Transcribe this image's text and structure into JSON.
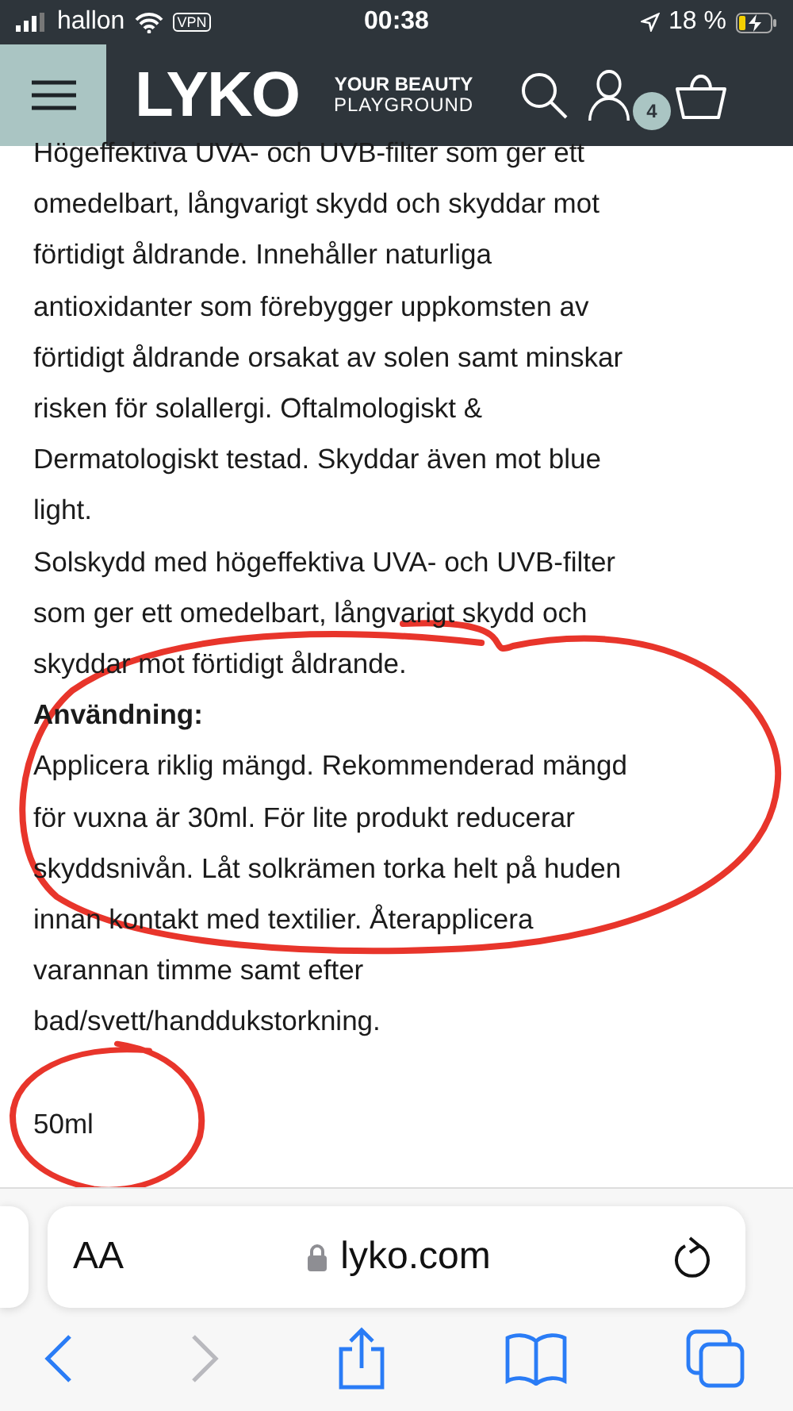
{
  "status_bar": {
    "carrier": "hallon",
    "vpn": "VPN",
    "time": "00:38",
    "battery": "18 %"
  },
  "header": {
    "logo": "LYKO",
    "tagline_top": "YOUR BEAUTY",
    "tagline_bottom": "PLAYGROUND",
    "cart_count": "4"
  },
  "content": [
    {
      "kind": "paragraph",
      "lines": [
        "Högeffektiva UVA- och UVB-filter som ger ett",
        "omedelbart, långvarigt skydd och skyddar mot",
        "förtidigt åldrande. Innehåller naturliga",
        "antioxidanter som förebygger uppkomsten av",
        "förtidigt åldrande orsakat av solen samt minskar",
        "risken för solallergi. Oftalmologiskt &",
        "Dermatologiskt testad. Skyddar även mot blue",
        "light."
      ]
    },
    {
      "kind": "paragraph",
      "lines": [
        "Solskydd med högeffektiva UVA- och UVB-filter",
        "som ger ett omedelbart, långvarigt skydd och",
        "skyddar mot förtidigt åldrande."
      ]
    },
    {
      "kind": "heading",
      "lines": [
        "Användning:"
      ]
    },
    {
      "kind": "paragraph",
      "lines": [
        "Applicera riklig mängd. Rekommenderad mängd",
        "för vuxna är 30ml. För lite produkt reducerar",
        "skyddsnivån. Låt solkrämen torka helt på huden",
        "innan kontakt med textilier. Återapplicera",
        "varannan timme samt efter",
        "bad/svett/handdukstorkning."
      ]
    },
    {
      "kind": "spacer"
    },
    {
      "kind": "paragraph",
      "lines": [
        "50ml"
      ]
    }
  ],
  "browser": {
    "text_size": "AA",
    "url": "lyko.com"
  }
}
